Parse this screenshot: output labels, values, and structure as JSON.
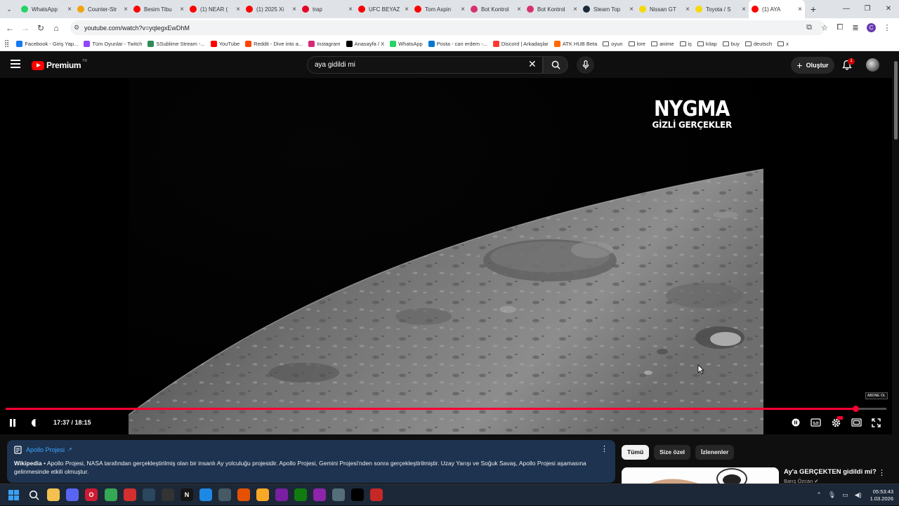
{
  "browser": {
    "tabs": [
      {
        "title": "WhatsApp",
        "color": "#25d366"
      },
      {
        "title": "Counter-Str",
        "color": "#f0a30a"
      },
      {
        "title": "Besim Tibu",
        "color": "#ff0000"
      },
      {
        "title": "(1) NEAR (",
        "color": "#ff0000"
      },
      {
        "title": "(1) 2025 Xi",
        "color": "#ff0000"
      },
      {
        "title": "trap",
        "color": "#e60023"
      },
      {
        "title": "UFC BEYAZ",
        "color": "#ff0000"
      },
      {
        "title": "Tom Aspin",
        "color": "#ff0000"
      },
      {
        "title": "Bot Kontrol",
        "color": "#d6336c"
      },
      {
        "title": "Bot Kontrol",
        "color": "#d6336c"
      },
      {
        "title": "Steam Top",
        "color": "#1b2838"
      },
      {
        "title": "Nissan GT",
        "color": "#f5d90a"
      },
      {
        "title": "Toyota / S",
        "color": "#f5d90a"
      },
      {
        "title": "(1) AYA",
        "color": "#ff0000"
      }
    ],
    "url": "youtube.com/watch?v=yqlegxEwDhM",
    "bookmarks": [
      {
        "label": "Facebook - Giriş Yap...",
        "color": "#1877f2",
        "type": "site"
      },
      {
        "label": "Tüm Oyunlar - Twitch",
        "color": "#9146ff",
        "type": "site"
      },
      {
        "label": "SSublime Stream -...",
        "color": "#2e8b57",
        "type": "site"
      },
      {
        "label": "YouTube",
        "color": "#ff0000",
        "type": "site"
      },
      {
        "label": "Reddit - Dive into a...",
        "color": "#ff4500",
        "type": "site"
      },
      {
        "label": "Instagram",
        "color": "#d62976",
        "type": "site"
      },
      {
        "label": "Anasayfa / X",
        "color": "#000000",
        "type": "site"
      },
      {
        "label": "WhatsApp",
        "color": "#25d366",
        "type": "site"
      },
      {
        "label": "Posta - can erdem -...",
        "color": "#0078d4",
        "type": "site"
      },
      {
        "label": "Discord | Arkadaşlar",
        "color": "#ff3b30",
        "type": "site"
      },
      {
        "label": "ATK HUB Beta",
        "color": "#ff6a00",
        "type": "site"
      },
      {
        "label": "oyun",
        "type": "folder"
      },
      {
        "label": "lore",
        "type": "folder"
      },
      {
        "label": "anime",
        "type": "folder"
      },
      {
        "label": "iş",
        "type": "folder"
      },
      {
        "label": "kitap",
        "type": "folder"
      },
      {
        "label": "buy",
        "type": "folder"
      },
      {
        "label": "deutsch",
        "type": "folder"
      },
      {
        "label": "x",
        "type": "folder"
      }
    ]
  },
  "youtube": {
    "logo_text": "Premium",
    "logo_region": "TR",
    "search_query": "aya gidildi mi",
    "create_label": "Oluştur",
    "notification_count": "1"
  },
  "player": {
    "watermark_title": "NYGMA",
    "watermark_subtitle": "GİZLİ GERÇEKLER",
    "subscribe_badge": "ABONE OL",
    "time_display": "17:37 / 18:15",
    "progress": 0.9653
  },
  "info_card": {
    "title": "Apollo Projesi",
    "source": "Wikipedia",
    "text": " • Apollo Projesi, NASA tarafından gerçekleştirilmiş olan bir insanlı Ay yolculuğu projesidir. Apollo Projesi, Gemini Projesi'nden sonra gerçekleştirilmiştir. Uzay Yarışı ve Soğuk Savaş, Apollo Projesi aşamasına gelinmesinde etkili olmuştur."
  },
  "sidebar": {
    "chips": [
      "Tümü",
      "Size özel",
      "İzlenenler"
    ],
    "recommendation": {
      "title": "Ay'a GERÇEKTEN gidildi mi?",
      "channel": "Barış Özcan"
    }
  },
  "taskbar": {
    "apps": [
      {
        "name": "file-explorer",
        "color": "#f2c14e",
        "glyph": ""
      },
      {
        "name": "discord",
        "color": "#5865f2",
        "glyph": ""
      },
      {
        "name": "opera",
        "color": "#cc1b32",
        "glyph": "O"
      },
      {
        "name": "chrome",
        "color": "#34a853",
        "glyph": ""
      },
      {
        "name": "app-red",
        "color": "#d32f2f",
        "glyph": ""
      },
      {
        "name": "steam",
        "color": "#2a475e",
        "glyph": ""
      },
      {
        "name": "app-dark",
        "color": "#333333",
        "glyph": ""
      },
      {
        "name": "netflix",
        "color": "#141414",
        "glyph": "N"
      },
      {
        "name": "app-blue",
        "color": "#1e88e5",
        "glyph": ""
      },
      {
        "name": "app-circle",
        "color": "#455a64",
        "glyph": ""
      },
      {
        "name": "app-orange",
        "color": "#e65100",
        "glyph": ""
      },
      {
        "name": "app-yellow",
        "color": "#f9a825",
        "glyph": ""
      },
      {
        "name": "app-purple",
        "color": "#7b1fa2",
        "glyph": ""
      },
      {
        "name": "xbox",
        "color": "#107c10",
        "glyph": ""
      },
      {
        "name": "app-violet",
        "color": "#8e24aa",
        "glyph": ""
      },
      {
        "name": "app-grey",
        "color": "#546e7a",
        "glyph": ""
      },
      {
        "name": "app-black",
        "color": "#000000",
        "glyph": ""
      },
      {
        "name": "shield-app",
        "color": "#c62828",
        "glyph": ""
      }
    ],
    "time": "05:53:43",
    "date": "1.03.2026"
  }
}
